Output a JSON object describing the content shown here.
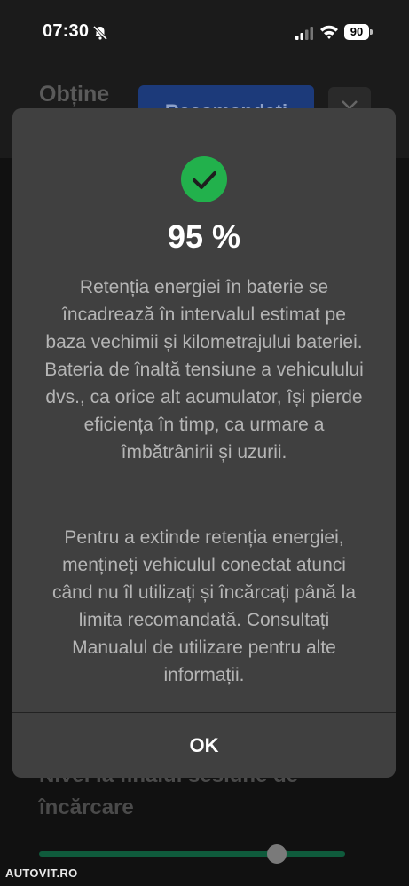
{
  "status_bar": {
    "time": "07:30",
    "battery_level": "90",
    "icons": [
      "bell-slash-icon",
      "cellular-signal-icon",
      "wifi-icon",
      "battery-icon"
    ]
  },
  "background": {
    "title": "Obține",
    "recommend_button_label": "Recomandați",
    "close_icon": "close-icon",
    "section_title": "Nivel la finalul sesiune de încărcare",
    "slider_value": 0.8,
    "slider_color": "#0f5b3c"
  },
  "dialog": {
    "icon": "check-circle-icon",
    "icon_color": "#22b14c",
    "percent": "95 %",
    "paragraph1": "Retenția energiei în baterie se încadrează în intervalul estimat pe baza vechimii și kilometrajului bateriei. Bateria de înaltă tensiune a vehiculului dvs., ca orice alt acumulator, își pierde eficiența în timp, ca urmare a îmbătrânirii și uzurii.",
    "paragraph2": "Pentru a extinde retenția energiei, mențineți vehiculul conectat atunci când nu îl utilizați și încărcați până la limita recomandată. Consultați Manualul de utilizare pentru alte informații.",
    "ok_label": "OK"
  },
  "watermark": "AUTOVIT.RO"
}
